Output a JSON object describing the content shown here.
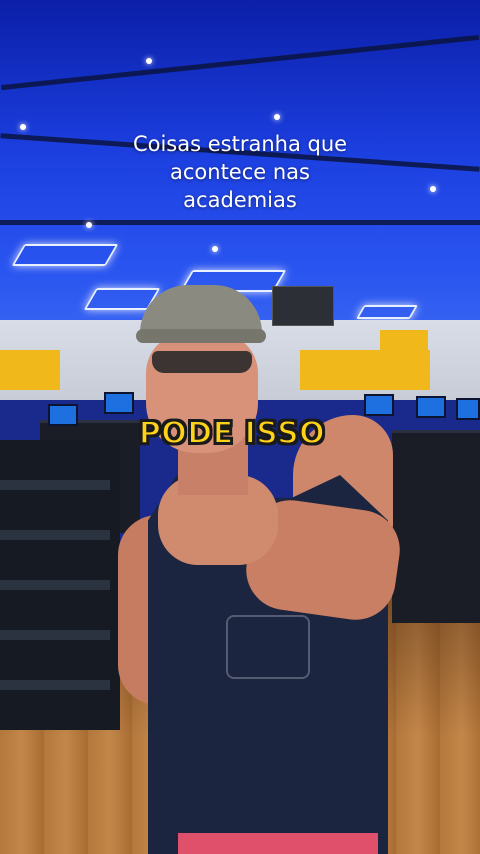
{
  "caption": {
    "line1": "Coisas estranha que",
    "line2": "acontece nas",
    "line3": "academias"
  },
  "badge": {
    "text": "PODE ISSO",
    "color": "#ffd21a"
  },
  "scene": {
    "ceiling_color": "#1c3fe0",
    "accent_yellow": "#f0b81a",
    "floor_color": "#b3783c"
  }
}
